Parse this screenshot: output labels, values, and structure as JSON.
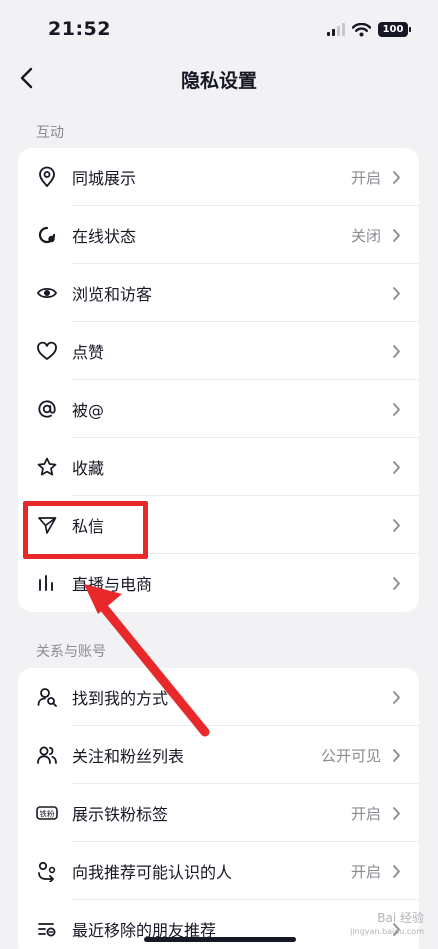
{
  "status_bar": {
    "time": "21:52",
    "battery": "100"
  },
  "nav": {
    "title": "隐私设置"
  },
  "sections": [
    {
      "label": "互动",
      "items": [
        {
          "label": "同城展示",
          "value": "开启",
          "icon": "location-pin-icon"
        },
        {
          "label": "在线状态",
          "value": "关闭",
          "icon": "online-status-icon"
        },
        {
          "label": "浏览和访客",
          "value": "",
          "icon": "eye-icon"
        },
        {
          "label": "点赞",
          "value": "",
          "icon": "heart-icon"
        },
        {
          "label": "被@",
          "value": "",
          "icon": "at-icon"
        },
        {
          "label": "收藏",
          "value": "",
          "icon": "star-icon"
        },
        {
          "label": "私信",
          "value": "",
          "icon": "send-icon"
        },
        {
          "label": "直播与电商",
          "value": "",
          "icon": "live-bars-icon"
        }
      ]
    },
    {
      "label": "关系与账号",
      "items": [
        {
          "label": "找到我的方式",
          "value": "",
          "icon": "find-user-icon"
        },
        {
          "label": "关注和粉丝列表",
          "value": "公开可见",
          "icon": "users-icon"
        },
        {
          "label": "展示铁粉标签",
          "value": "开启",
          "icon": "fan-badge-icon"
        },
        {
          "label": "向我推荐可能认识的人",
          "value": "开启",
          "icon": "recommend-icon"
        },
        {
          "label": "最近移除的朋友推荐",
          "value": "",
          "icon": "list-icon"
        }
      ]
    }
  ],
  "annotation": {
    "color": "#e8282b"
  },
  "watermark": {
    "text": "Bai 经验",
    "sub": "jingyan.baidu.com"
  }
}
